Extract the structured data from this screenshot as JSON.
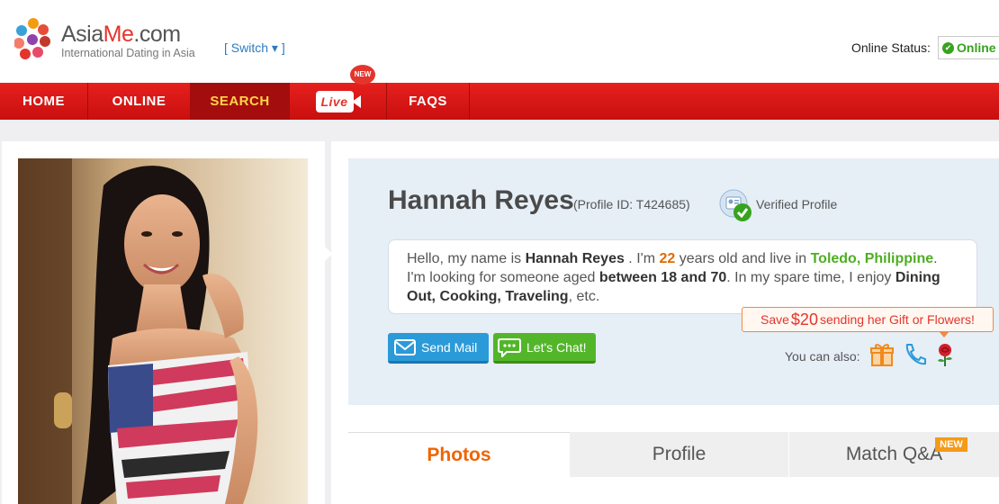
{
  "header": {
    "brand_main": "Asia",
    "brand_accent": "Me",
    "brand_suffix": ".com",
    "tagline": "International Dating in Asia",
    "switch_label": "[ Switch ▾ ]",
    "status_label": "Online Status:",
    "status_value": "Online"
  },
  "nav": {
    "items": [
      {
        "label": "HOME"
      },
      {
        "label": "ONLINE"
      },
      {
        "label": "SEARCH"
      },
      {
        "label": "Live"
      },
      {
        "label": "FAQS"
      }
    ],
    "new_badge": "NEW"
  },
  "profile": {
    "name": "Hannah Reyes",
    "profile_id": "(Profile ID: T424685)",
    "verified_label": "Verified Profile",
    "bio": {
      "p1": "Hello, my name is ",
      "name": "Hannah Reyes",
      "p2": " . I'm ",
      "age": "22",
      "p3": " years old and live in ",
      "location": "Toledo, Philippine",
      "p4": ". I'm looking for someone aged ",
      "age_range": "between 18 and 70",
      "p5": ". In my spare time, I enjoy ",
      "hobbies": "Dining Out, Cooking, Traveling",
      "p6": ", etc."
    }
  },
  "actions": {
    "send_mail": "Send Mail",
    "chat": "Let's Chat!",
    "promo_prefix": "Save ",
    "promo_amount": "$20",
    "promo_suffix": " sending her Gift or Flowers!",
    "also_label": "You can also:",
    "icons": [
      "gift-icon",
      "phone-icon",
      "rose-icon"
    ]
  },
  "tabs": [
    {
      "label": "Photos"
    },
    {
      "label": "Profile"
    },
    {
      "label": "Match Q&A"
    }
  ],
  "tab_new_badge": "NEW",
  "colors": {
    "brand_red": "#e4352d",
    "nav_red": "#d8150f",
    "active_tab_orange": "#f06400",
    "online_green": "#37a31e",
    "mail_blue": "#2b9ad8",
    "chat_green": "#53b62a"
  }
}
